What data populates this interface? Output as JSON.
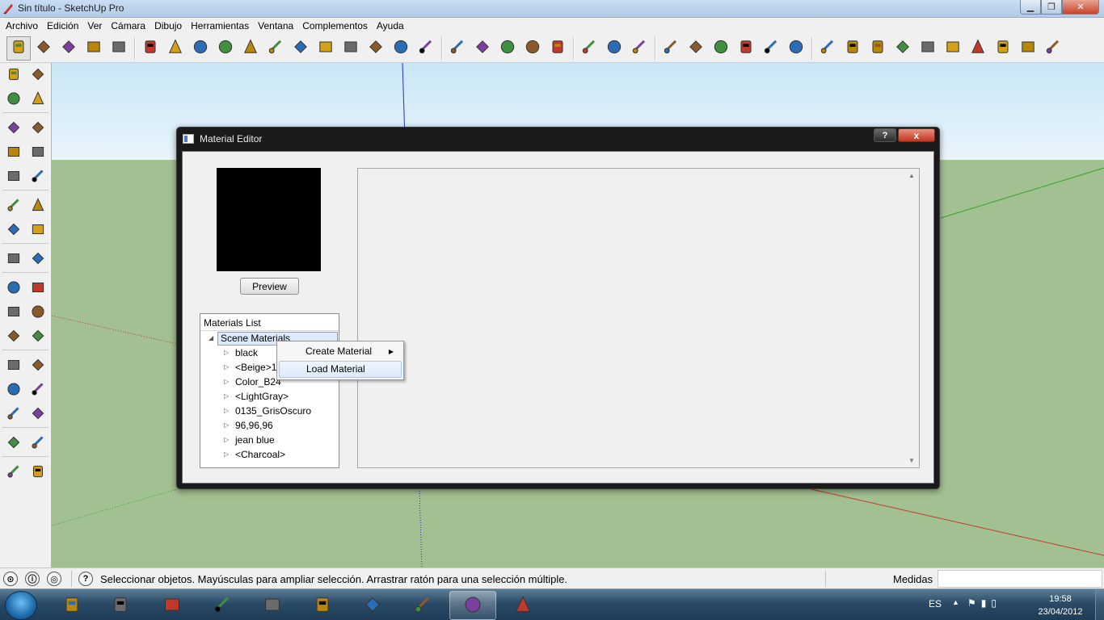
{
  "window": {
    "title": "Sin título - SketchUp Pro",
    "min_icon": "minimize-icon",
    "max_icon": "maximize-icon",
    "close_icon": "close-icon"
  },
  "menubar": {
    "items": [
      "Archivo",
      "Edición",
      "Ver",
      "Cámara",
      "Dibujo",
      "Herramientas",
      "Ventana",
      "Complementos",
      "Ayuda"
    ]
  },
  "toolbar_top": {
    "groups": [
      [
        "select-icon",
        "pencil-icon",
        "rectangle-icon",
        "circle-icon",
        "arc-icon"
      ],
      [
        "make-component-icon",
        "eraser-icon",
        "tape-measure-icon",
        "paint-bucket-icon",
        "push-pull-icon",
        "move-icon",
        "rotate-icon",
        "follow-me-icon",
        "orbit-icon",
        "pan-icon",
        "zoom-icon",
        "zoom-extents-icon"
      ],
      [
        "previous-view-icon",
        "next-view-icon",
        "add-location-icon",
        "terrain-icon",
        "google-earth-icon"
      ],
      [
        "get-models-icon",
        "share-model-icon",
        "share-component-icon"
      ],
      [
        "iso-view-icon",
        "top-view-icon",
        "front-view-icon",
        "right-view-icon",
        "back-view-icon",
        "left-view-icon"
      ],
      [
        "plugin-m-icon",
        "plugin-tag-icon",
        "plugin-r-icon",
        "help-icon",
        "plugin-label-icon",
        "sun-icon",
        "light-icon",
        "flag-icon",
        "lamp-icon",
        "sphere-icon"
      ]
    ]
  },
  "toolbar_left": {
    "rows": [
      [
        "select-icon",
        "component-icon"
      ],
      [
        "paint-bucket-icon",
        "eraser-icon"
      ],
      [
        "rectangle-icon",
        "pencil-icon"
      ],
      [
        "circle-icon",
        "arc-icon"
      ],
      [
        "polygon-icon",
        "freehand-icon"
      ],
      [
        "move-icon",
        "push-pull-icon"
      ],
      [
        "rotate-icon",
        "follow-me-icon"
      ],
      [
        "scale-icon",
        "offset-icon"
      ],
      [
        "tape-measure-icon",
        "dimension-icon"
      ],
      [
        "protractor-icon",
        "text-icon"
      ],
      [
        "axes-icon",
        "3d-text-icon"
      ],
      [
        "orbit-icon",
        "pan-icon"
      ],
      [
        "zoom-icon",
        "zoom-extents-icon"
      ],
      [
        "previous-view-icon",
        "next-view-icon"
      ],
      [
        "position-camera-icon",
        "look-around-icon"
      ],
      [
        "walk-icon",
        "section-plane-icon"
      ]
    ]
  },
  "dialog": {
    "title": "Material Editor",
    "help_label": "?",
    "close_label": "x",
    "preview_button": "Preview",
    "materials_list_header": "Materials List",
    "tree_root": "Scene Materials",
    "materials": [
      "black",
      "<Beige>1",
      "Color_B24",
      "<LightGray>",
      "0135_GrisOscuro",
      "96,96,96",
      "jean blue",
      "<Charcoal>"
    ],
    "preview_color": "#000000"
  },
  "context_menu": {
    "items": [
      {
        "label": "Create Material",
        "has_submenu": true
      },
      {
        "label": "Load Material",
        "has_submenu": false,
        "highlighted": true
      }
    ]
  },
  "statusbar": {
    "text": "Seleccionar objetos. Mayúsculas para ampliar selección. Arrastrar ratón para una selección múltiple.",
    "measure_label": "Medidas",
    "measure_value": ""
  },
  "taskbar": {
    "apps": [
      "hp-icon",
      "media-player-icon",
      "network-icon",
      "firefox-icon",
      "chrome-icon",
      "file-explorer-icon",
      "illustrator-icon",
      "sticky-notes-icon",
      "sketchup-icon",
      "paint-icon"
    ],
    "active_app": "sketchup-icon",
    "language": "ES",
    "time": "19:58",
    "date": "23/04/2012"
  },
  "colors": {
    "ground": "#a2c091",
    "sky": "#d6eef9",
    "axis_red": "#c23a2c",
    "axis_green": "#2ea52a",
    "axis_blue": "#2d2fb8"
  }
}
